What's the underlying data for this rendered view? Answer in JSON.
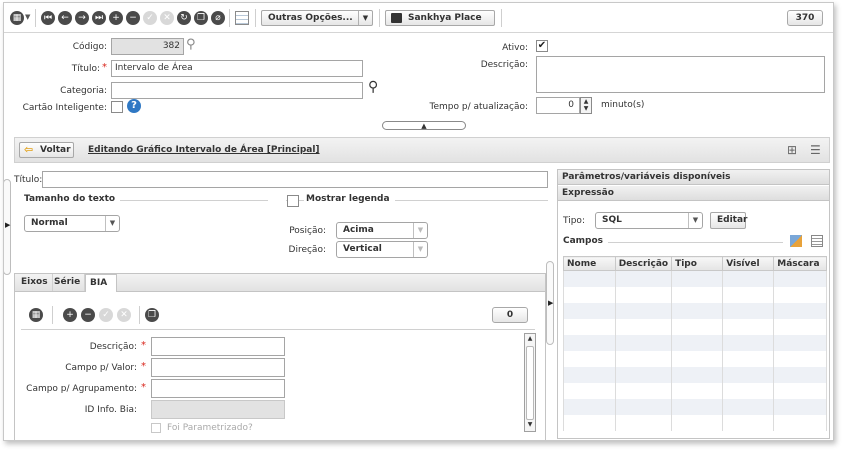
{
  "toolbar": {
    "options_label": "Outras Opções...",
    "place_label": "Sankhya Place",
    "count": "370"
  },
  "form": {
    "codigo_label": "Código:",
    "codigo_value": "382",
    "titulo_label": "Título:",
    "titulo_value": "Intervalo de Área",
    "categoria_label": "Categoria:",
    "categoria_value": "",
    "cartao_label": "Cartão Inteligente:",
    "ativo_label": "Ativo:",
    "ativo_checked": true,
    "descricao_label": "Descrição:",
    "descricao_value": "",
    "tempo_label": "Tempo p/ atualização:",
    "tempo_value": "0",
    "tempo_unit": "minuto(s)"
  },
  "editbar": {
    "back_label": "Voltar",
    "heading": "Editando Gráfico Intervalo de Área [Principal]"
  },
  "chart_settings": {
    "titulo_label": "Título:",
    "titulo_value": "",
    "tamanho_title": "Tamanho do texto",
    "tamanho_value": "Normal",
    "legenda_label": "Mostrar legenda",
    "posicao_label": "Posição:",
    "posicao_value": "Acima",
    "direcao_label": "Direção:",
    "direcao_value": "Vertical"
  },
  "tabs": [
    {
      "label": "Eixos"
    },
    {
      "label": "Série"
    },
    {
      "label": "BIA",
      "active": true
    }
  ],
  "bia": {
    "count": "0",
    "descricao_label": "Descrição:",
    "campo_valor_label": "Campo p/ Valor:",
    "campo_agrup_label": "Campo p/ Agrupamento:",
    "id_info_label": "ID Info. Bia:",
    "parametrizado_label": "Foi Parametrizado?"
  },
  "params_panel": {
    "title": "Parâmetros/variáveis disponíveis",
    "expressao_title": "Expressão",
    "tipo_label": "Tipo:",
    "tipo_value": "SQL",
    "editar_label": "Editar",
    "campos_title": "Campos",
    "columns": [
      "Nome",
      "Descrição",
      "Tipo",
      "Visível",
      "Máscara"
    ]
  },
  "colors": {
    "required": "#d9261c",
    "help_icon": "#2f78c4",
    "grid_alt_row": "#eef1f6",
    "toolbar_icon": "#4a4a4a"
  }
}
